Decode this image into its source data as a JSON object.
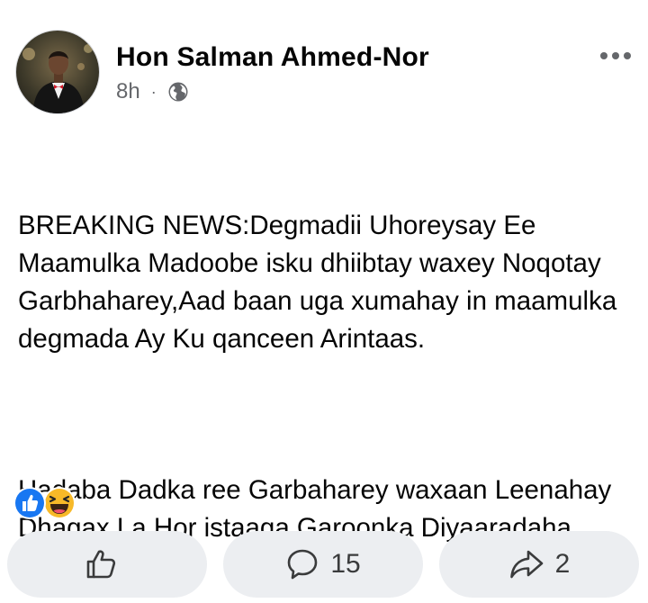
{
  "post": {
    "author": "Hon Salman Ahmed-Nor",
    "time": "8h",
    "separator": "·",
    "audience_icon": "globe-icon",
    "menu_icon": "more-options-icon",
    "paragraphs": [
      "BREAKING NEWS:Degmadii Uhoreysay Ee Maamulka Madoobe isku dhiibtay waxey Noqotay Garbhaharey,Aad baan uga xumahay in maamulka degmada Ay Ku qanceen Arintaas.",
      "Hadaba Dadka ree Garbaharey waxaan Leenahay Dhagax La Hor istaaga Garoonka Diyaaradaha"
    ]
  },
  "reactions": [
    {
      "icon": "like-reaction-icon",
      "color": "#1877f2"
    },
    {
      "icon": "haha-reaction-icon",
      "color": "#f7b928"
    }
  ],
  "actions": {
    "like": {
      "icon": "thumbs-up-icon",
      "count": ""
    },
    "comment": {
      "icon": "comment-icon",
      "count": "15"
    },
    "share": {
      "icon": "share-icon",
      "count": "2"
    }
  },
  "colors": {
    "text": "#050505",
    "secondary": "#65676b",
    "button_bg": "#eceef1",
    "like_blue": "#1877f2"
  }
}
